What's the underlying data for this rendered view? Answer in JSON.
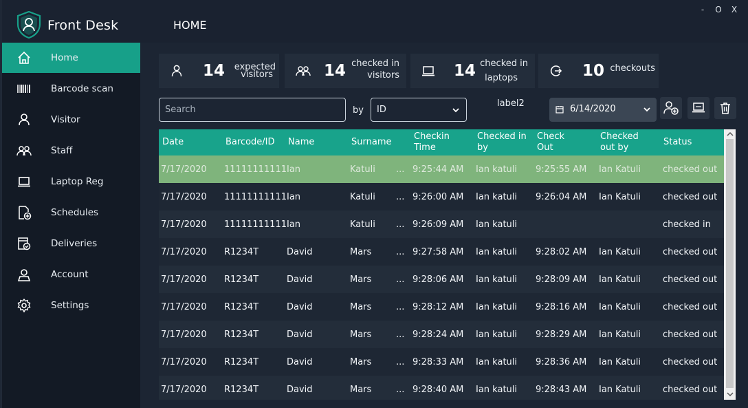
{
  "app": {
    "name": "Front Desk",
    "page_title": "HOME"
  },
  "window_controls": {
    "minimize": "-",
    "maximize": "O",
    "close": "X"
  },
  "sidebar": {
    "items": [
      {
        "label": "Home",
        "icon": "home-icon",
        "active": true
      },
      {
        "label": "Barcode scan",
        "icon": "barcode-icon"
      },
      {
        "label": "Visitor",
        "icon": "user-icon"
      },
      {
        "label": "Staff",
        "icon": "users-icon"
      },
      {
        "label": "Laptop Reg",
        "icon": "laptop-icon"
      },
      {
        "label": "Schedules",
        "icon": "schedule-icon"
      },
      {
        "label": "Deliveries",
        "icon": "delivery-icon"
      },
      {
        "label": "Account",
        "icon": "account-icon"
      },
      {
        "label": "Settings",
        "icon": "gear-icon"
      }
    ]
  },
  "stats": [
    {
      "value": "14",
      "label_line1": "expected",
      "label_line2": "visitors",
      "icon": "user-icon"
    },
    {
      "value": "14",
      "label_line1": "checked in",
      "label_line2": "visitors",
      "icon": "users-icon"
    },
    {
      "value": "14",
      "label_line1": "checked in",
      "label_line2": "laptops",
      "icon": "laptop-icon"
    },
    {
      "value": "10",
      "label_line1": "checkouts",
      "label_line2": "",
      "icon": "checkout-icon"
    }
  ],
  "search": {
    "placeholder": "Search",
    "by_label": "by",
    "by_value": "ID"
  },
  "label2": "label2",
  "date_picker": {
    "value": "6/14/2020"
  },
  "table": {
    "columns": [
      "Date",
      "Barcode/ID",
      "Name",
      "Surname",
      "Checkin Time",
      "Checked in by",
      "Check Out",
      "Checked out by",
      "Status"
    ],
    "rows": [
      [
        "7/17/2020",
        "11111111111",
        "Ian",
        "Katuli",
        "...",
        "9:25:44 AM",
        "Ian katuli",
        "9:25:55 AM",
        "Ian Katuli",
        "checked out"
      ],
      [
        "7/17/2020",
        "11111111111",
        "Ian",
        "Katuli",
        "...",
        "9:26:00 AM",
        "Ian katuli",
        "9:26:04 AM",
        "Ian Katuli",
        "checked out"
      ],
      [
        "7/17/2020",
        "11111111111",
        "Ian",
        "Katuli",
        "...",
        "9:26:09 AM",
        "Ian katuli",
        "",
        "",
        "checked in"
      ],
      [
        "7/17/2020",
        "R1234T",
        "David",
        "Mars",
        "...",
        "9:27:58 AM",
        "Ian katuli",
        "9:28:02 AM",
        "Ian Katuli",
        "checked out"
      ],
      [
        "7/17/2020",
        "R1234T",
        "David",
        "Mars",
        "...",
        "9:28:06 AM",
        "Ian katuli",
        "9:28:09 AM",
        "Ian Katuli",
        "checked out"
      ],
      [
        "7/17/2020",
        "R1234T",
        "David",
        "Mars",
        "...",
        "9:28:12 AM",
        "Ian katuli",
        "9:28:16 AM",
        "Ian Katuli",
        "checked out"
      ],
      [
        "7/17/2020",
        "R1234T",
        "David",
        "Mars",
        "...",
        "9:28:24 AM",
        "Ian katuli",
        "9:28:29 AM",
        "Ian Katuli",
        "checked out"
      ],
      [
        "7/17/2020",
        "R1234T",
        "David",
        "Mars",
        "...",
        "9:28:33 AM",
        "Ian katuli",
        "9:28:36 AM",
        "Ian Katuli",
        "checked out"
      ],
      [
        "7/17/2020",
        "R1234T",
        "David",
        "Mars",
        "...",
        "9:28:40 AM",
        "Ian katuli",
        "9:28:43 AM",
        "Ian Katuli",
        "checked out"
      ]
    ],
    "selected_row": 0
  },
  "colors": {
    "accent": "#17a089",
    "selected_row": "#7fb47c",
    "sidebar_bg": "#131a25",
    "content_bg": "#1c2533"
  }
}
